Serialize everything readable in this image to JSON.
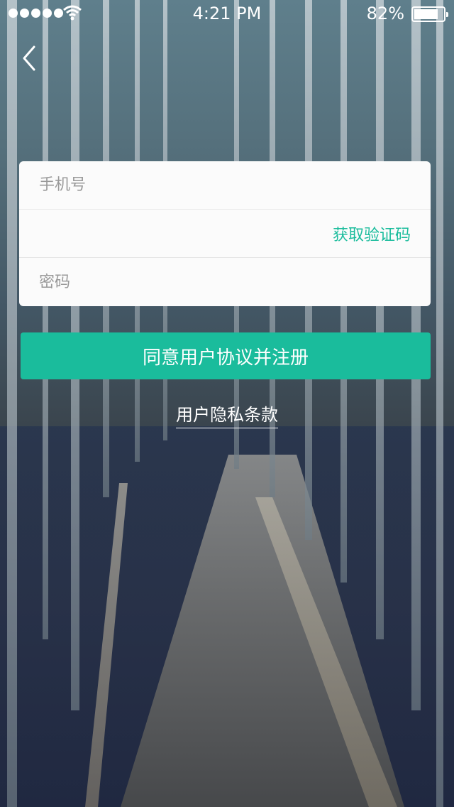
{
  "status_bar": {
    "signal_bars": 5,
    "time": "4:21 PM",
    "battery_text": "82%",
    "battery_level": 0.82,
    "icons": [
      "signal-icon",
      "wifi-icon",
      "battery-icon"
    ]
  },
  "nav": {
    "back_icon": "chevron-left-icon"
  },
  "form": {
    "phone_placeholder": "手机号",
    "code_placeholder": "",
    "get_code_label": "获取验证码",
    "password_placeholder": "密码"
  },
  "register_button_label": "同意用户协议并注册",
  "privacy_link_label": "用户隐私条款",
  "colors": {
    "accent": "#1abc9c",
    "placeholder": "#999999",
    "text_light": "#ffffff"
  }
}
